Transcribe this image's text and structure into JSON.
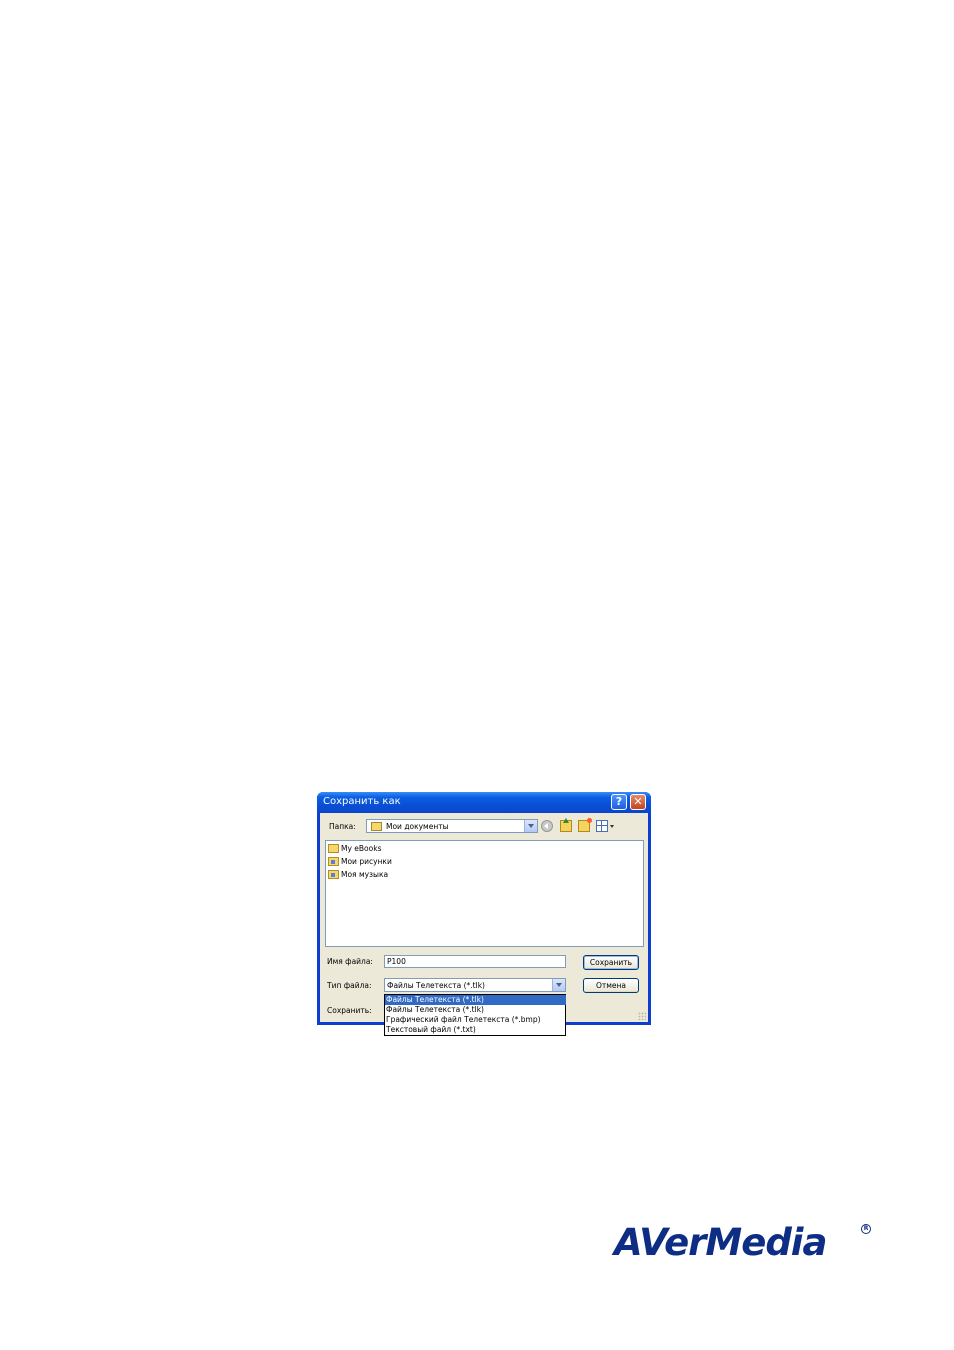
{
  "dialog": {
    "title": "Сохранить как",
    "help_glyph": "?",
    "close_glyph": "✕",
    "folder_label": "Папка:",
    "folder_value": "Мои документы",
    "files": [
      {
        "name": "My eBooks",
        "icon": "folder-icon"
      },
      {
        "name": "Мои рисунки",
        "icon": "pictures-folder-icon"
      },
      {
        "name": "Моя музыка",
        "icon": "music-folder-icon"
      }
    ],
    "filename_label": "Имя файла:",
    "filename_value": "P100",
    "filetype_label": "Тип файла:",
    "filetype_value": "Файлы Телетекста (*.tlk)",
    "save_in_label": "Сохранить:",
    "save_button": "Сохранить",
    "cancel_button": "Отмена",
    "filetype_options": [
      {
        "label": "Файлы Телетекста (*.tlk)",
        "selected": true
      },
      {
        "label": "Файлы Телетекста (*.tlk)",
        "selected": false
      },
      {
        "label": "Графический файл Телетекста (*.bmp)",
        "selected": false
      },
      {
        "label": "Текстовый файл (*.txt)",
        "selected": false
      }
    ]
  },
  "logo": {
    "text": "AVerMedia",
    "registered": "R"
  },
  "colors": {
    "titlebar": "#0a4fd6",
    "selection": "#316ac5",
    "logo": "#0e2d84",
    "dialog_bg": "#ece9d8"
  }
}
